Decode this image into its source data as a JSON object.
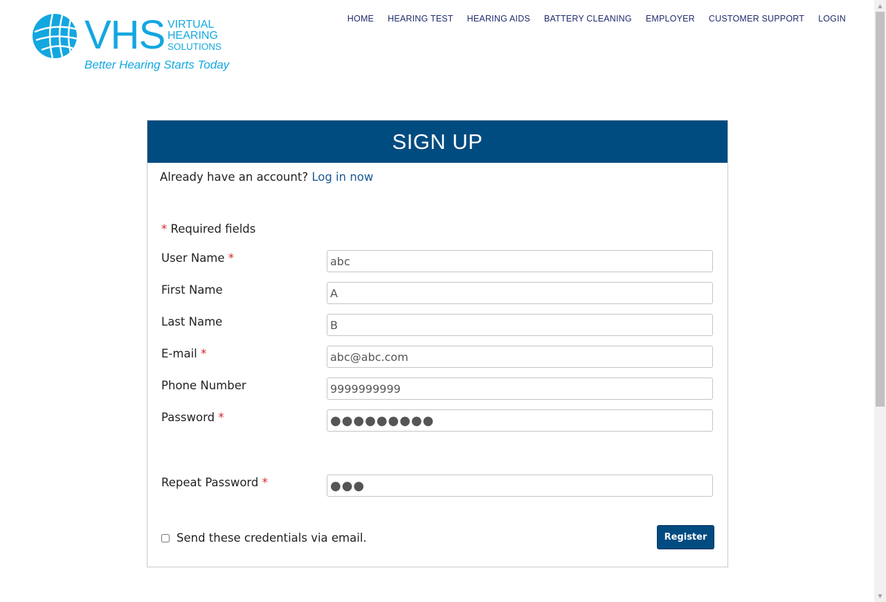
{
  "logo": {
    "letters": "VHS",
    "line1": "VIRTUAL",
    "line2": "HEARING",
    "line3": "SOLUTIONS",
    "tagline": "Better Hearing Starts Today",
    "color": "#13a7e0"
  },
  "nav": {
    "items": [
      "HOME",
      "HEARING TEST",
      "HEARING AIDS",
      "BATTERY CLEANING",
      "EMPLOYER",
      "CUSTOMER SUPPORT",
      "LOGIN"
    ]
  },
  "card": {
    "title": "SIGN UP",
    "header_color": "#004b80",
    "already_text": "Already have an account?",
    "login_link": "Log in now",
    "required_star": "*",
    "required_text": "Required fields"
  },
  "form": {
    "fields": [
      {
        "label": "User Name",
        "required": "*",
        "value": "abc"
      },
      {
        "label": "First Name",
        "required": "",
        "value": "A"
      },
      {
        "label": "Last Name",
        "required": "",
        "value": "B"
      },
      {
        "label": "E-mail",
        "required": "*",
        "value": "abc@abc.com"
      },
      {
        "label": "Phone Number",
        "required": "",
        "value": "9999999999"
      },
      {
        "label": "Password",
        "required": "*",
        "value": "●●●●●●●●●"
      },
      {
        "label": "Repeat Password",
        "required": "*",
        "value": "●●●"
      }
    ],
    "send_credentials_label": "Send these credentials via email.",
    "register_label": "Register"
  }
}
